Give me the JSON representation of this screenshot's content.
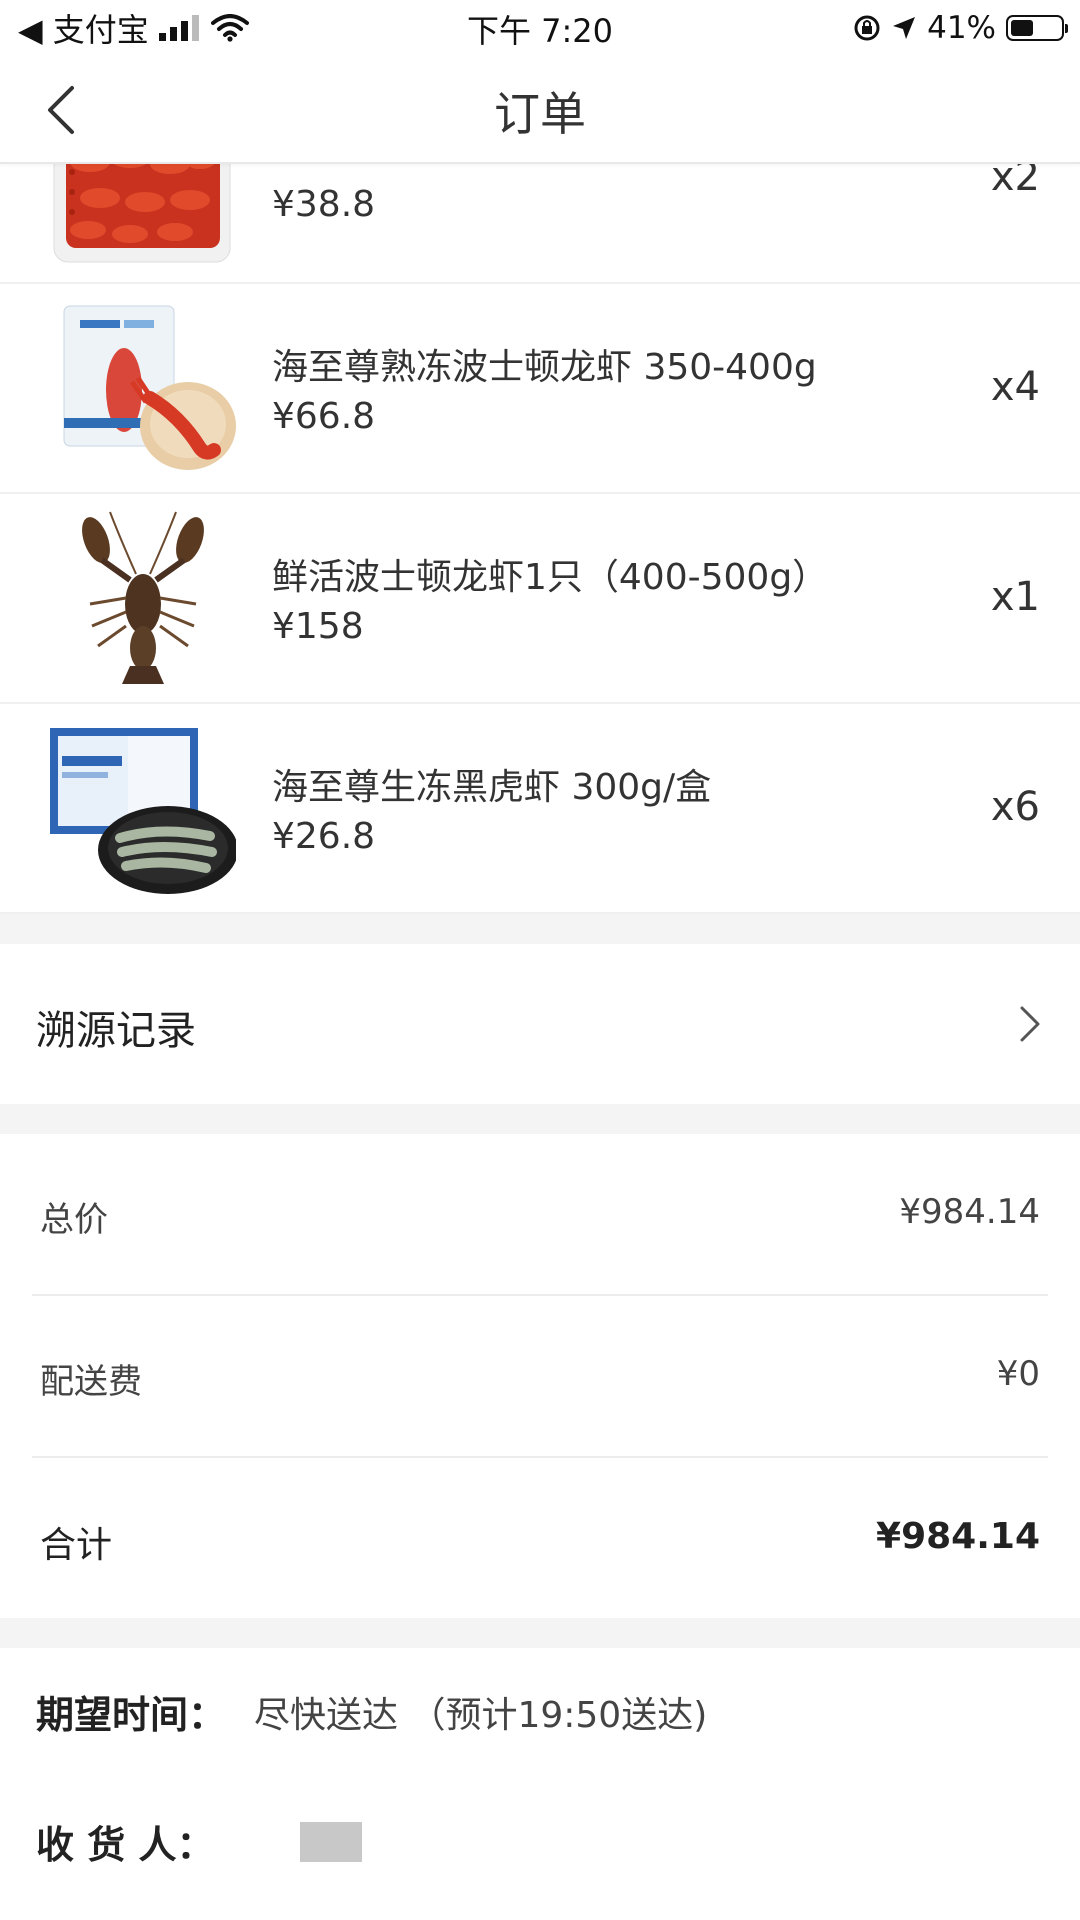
{
  "status_bar": {
    "back_app": "◀ 支付宝",
    "time": "下午 7:20",
    "battery": "41%",
    "battery_level": 0.41
  },
  "navbar": {
    "title": "订单"
  },
  "products": [
    {
      "name": "",
      "price": "¥38.8",
      "qty": "x2",
      "image": "crayfish-tray"
    },
    {
      "name": "海至尊熟冻波士顿龙虾 350-400g",
      "price": "¥66.8",
      "qty": "x4",
      "image": "frozen-lobster-pack"
    },
    {
      "name": "鲜活波士顿龙虾1只（400-500g）",
      "price": "¥158",
      "qty": "x1",
      "image": "live-lobster"
    },
    {
      "name": "海至尊生冻黑虎虾 300g/盒",
      "price": "¥26.8",
      "qty": "x6",
      "image": "tiger-shrimp-box"
    }
  ],
  "trace": {
    "label": "溯源记录"
  },
  "summary": {
    "total_label": "总价",
    "total_value": "¥984.14",
    "delivery_label": "配送费",
    "delivery_value": "¥0",
    "sum_label": "合计",
    "sum_value": "¥984.14"
  },
  "info": {
    "expected_label": "期望时间：",
    "expected_value": "尽快送达 （预计19:50送达)",
    "receiver_label": "收 货 人："
  }
}
